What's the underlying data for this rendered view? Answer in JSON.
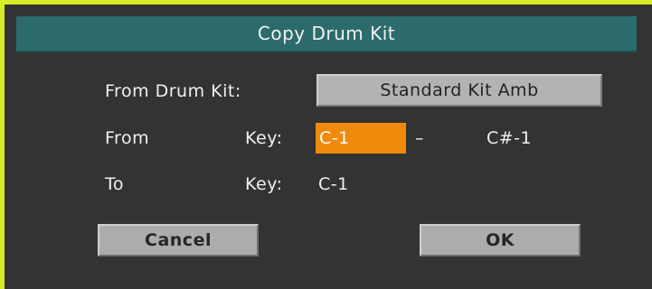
{
  "dialog": {
    "title": "Copy Drum Kit"
  },
  "from_drum_kit": {
    "label": "From Drum Kit:",
    "value": "Standard Kit Amb"
  },
  "from_row": {
    "label": "From",
    "key_label": "Key:",
    "start_key": "C-1",
    "separator": "–",
    "end_key": "C#-1"
  },
  "to_row": {
    "label": "To",
    "key_label": "Key:",
    "key": "C-1"
  },
  "buttons": {
    "cancel": "Cancel",
    "ok": "OK"
  },
  "colors": {
    "frame_accent": "#d7ed25",
    "title_bar": "#2c6b6b",
    "selected_field": "#f08a0c",
    "dialog_background": "#333333",
    "button_face": "#acacac"
  }
}
